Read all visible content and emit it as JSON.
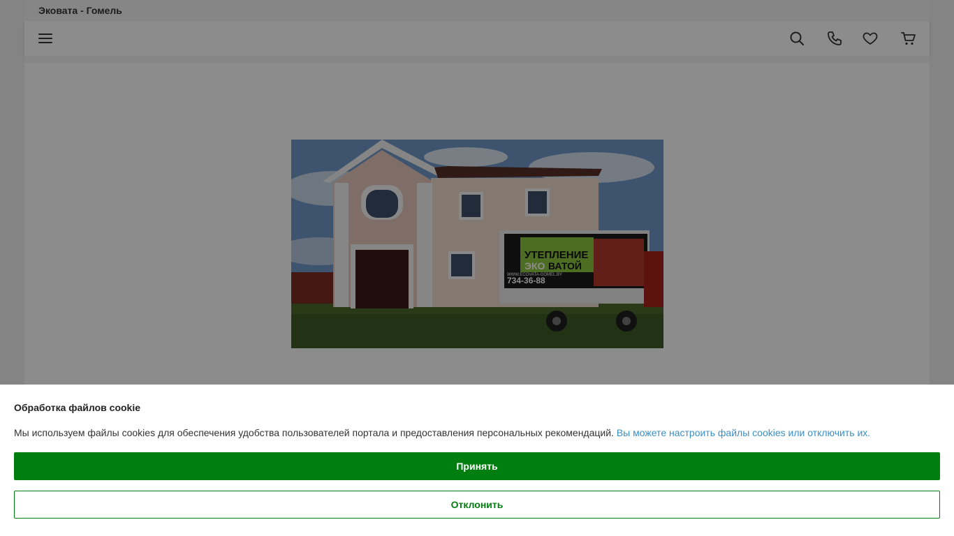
{
  "header": {
    "site_name": "Эковата - Гомель"
  },
  "navbar": {
    "icons": [
      "menu-icon",
      "search-icon",
      "phone-icon",
      "heart-icon",
      "cart-icon"
    ]
  },
  "hero": {
    "banner_line1": "УТЕПЛЕНИЕ",
    "banner_line2_a": "ЭКО",
    "banner_line2_b": "ВАТОЙ",
    "banner_url": "WWW.ECOVATA-GOMEL.BY",
    "banner_phone": "734-36-88"
  },
  "cookie": {
    "title": "Обработка файлов cookie",
    "text": "Мы используем файлы cookies для обеспечения удобства пользователей портала и предоставления персональных рекомендаций.",
    "link": "Вы можете настроить файлы cookies или отключить их.",
    "accept_label": "Принять",
    "decline_label": "Отклонить"
  },
  "colors": {
    "accent": "#007f10",
    "link": "#3a8fc7",
    "overlay": "rgba(0,0,0,0.45)"
  }
}
